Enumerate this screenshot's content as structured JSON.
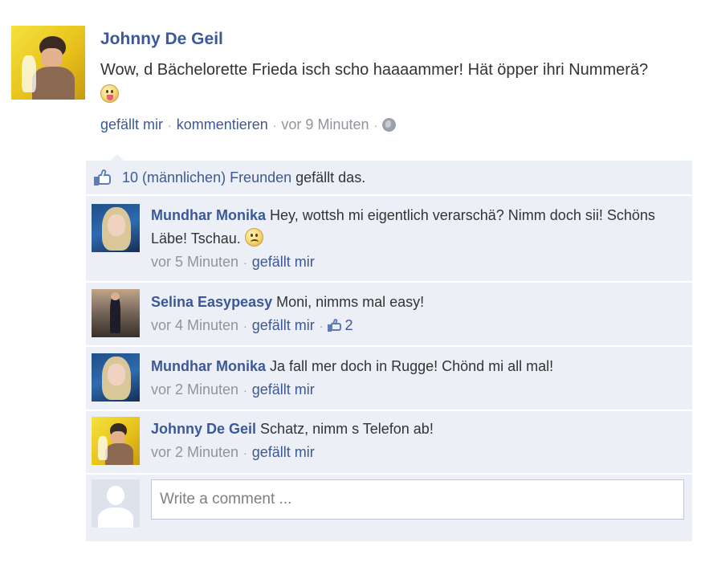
{
  "post": {
    "author": "Johnny De Geil",
    "text": "Wow, d Bächelorette Frieda isch scho haaaammer! Hät öpper ihri Nummerä?",
    "emoji_icon": "tongue-out-emoji",
    "actions": {
      "like": "gefällt mir",
      "comment": "kommentieren",
      "time": "vor 9 Minuten",
      "privacy_icon": "globe-icon"
    }
  },
  "likes": {
    "count_text": "10 (männlichen) Freunden",
    "suffix": "gefällt das."
  },
  "comments": [
    {
      "author": "Mundhar Monika",
      "text": "Hey, wottsh mi eigentlich verarschä? Nimm doch sii! Schöns Läbe! Tschau.",
      "emoji_icon": "sad-emoji",
      "time": "vor 5 Minuten",
      "like": "gefällt mir"
    },
    {
      "author": "Selina Easypeasy",
      "text": "Moni, nimms mal easy!",
      "time": "vor 4 Minuten",
      "like": "gefällt mir",
      "like_count": "2"
    },
    {
      "author": "Mundhar Monika",
      "text": "Ja fall mer doch in Rugge! Chönd mi all mal!",
      "time": "vor 2 Minuten",
      "like": "gefällt mir"
    },
    {
      "author": "Johnny De Geil",
      "text": "Schatz, nimm s Telefon ab!",
      "time": "vor 2 Minuten",
      "like": "gefällt mir"
    }
  ],
  "compose": {
    "placeholder": "Write a comment ..."
  },
  "colors": {
    "link": "#3b5998",
    "muted": "#90949c",
    "panel": "#eceff5"
  }
}
